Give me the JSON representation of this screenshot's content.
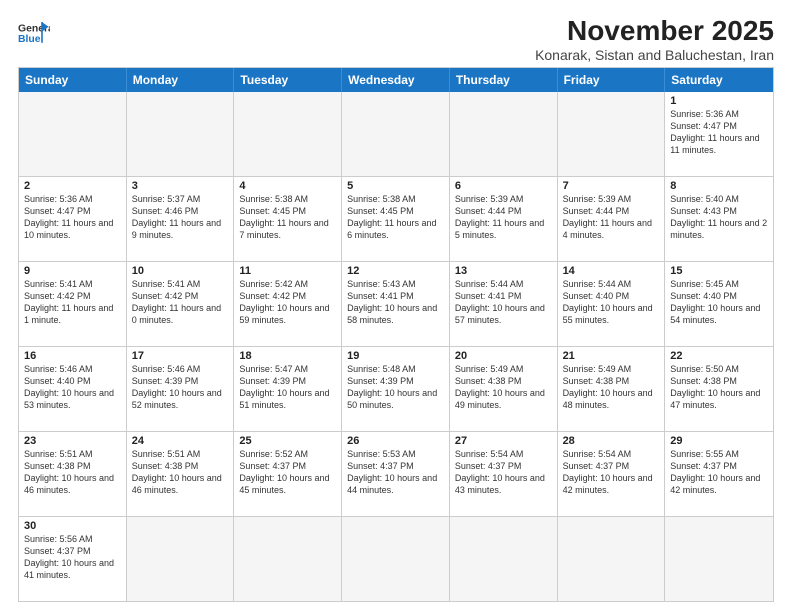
{
  "logo": {
    "line1": "General",
    "line2": "Blue"
  },
  "title": "November 2025",
  "subtitle": "Konarak, Sistan and Baluchestan, Iran",
  "days_of_week": [
    "Sunday",
    "Monday",
    "Tuesday",
    "Wednesday",
    "Thursday",
    "Friday",
    "Saturday"
  ],
  "weeks": [
    [
      {
        "day": "",
        "info": "",
        "empty": true
      },
      {
        "day": "",
        "info": "",
        "empty": true
      },
      {
        "day": "",
        "info": "",
        "empty": true
      },
      {
        "day": "",
        "info": "",
        "empty": true
      },
      {
        "day": "",
        "info": "",
        "empty": true
      },
      {
        "day": "",
        "info": "",
        "empty": true
      },
      {
        "day": "1",
        "info": "Sunrise: 5:36 AM\nSunset: 4:47 PM\nDaylight: 11 hours\nand 11 minutes.",
        "empty": false
      }
    ],
    [
      {
        "day": "2",
        "info": "Sunrise: 5:36 AM\nSunset: 4:47 PM\nDaylight: 11 hours\nand 10 minutes.",
        "empty": false
      },
      {
        "day": "3",
        "info": "Sunrise: 5:37 AM\nSunset: 4:46 PM\nDaylight: 11 hours\nand 9 minutes.",
        "empty": false
      },
      {
        "day": "4",
        "info": "Sunrise: 5:38 AM\nSunset: 4:45 PM\nDaylight: 11 hours\nand 7 minutes.",
        "empty": false
      },
      {
        "day": "5",
        "info": "Sunrise: 5:38 AM\nSunset: 4:45 PM\nDaylight: 11 hours\nand 6 minutes.",
        "empty": false
      },
      {
        "day": "6",
        "info": "Sunrise: 5:39 AM\nSunset: 4:44 PM\nDaylight: 11 hours\nand 5 minutes.",
        "empty": false
      },
      {
        "day": "7",
        "info": "Sunrise: 5:39 AM\nSunset: 4:44 PM\nDaylight: 11 hours\nand 4 minutes.",
        "empty": false
      },
      {
        "day": "8",
        "info": "Sunrise: 5:40 AM\nSunset: 4:43 PM\nDaylight: 11 hours\nand 2 minutes.",
        "empty": false
      }
    ],
    [
      {
        "day": "9",
        "info": "Sunrise: 5:41 AM\nSunset: 4:42 PM\nDaylight: 11 hours\nand 1 minute.",
        "empty": false
      },
      {
        "day": "10",
        "info": "Sunrise: 5:41 AM\nSunset: 4:42 PM\nDaylight: 11 hours\nand 0 minutes.",
        "empty": false
      },
      {
        "day": "11",
        "info": "Sunrise: 5:42 AM\nSunset: 4:42 PM\nDaylight: 10 hours\nand 59 minutes.",
        "empty": false
      },
      {
        "day": "12",
        "info": "Sunrise: 5:43 AM\nSunset: 4:41 PM\nDaylight: 10 hours\nand 58 minutes.",
        "empty": false
      },
      {
        "day": "13",
        "info": "Sunrise: 5:44 AM\nSunset: 4:41 PM\nDaylight: 10 hours\nand 57 minutes.",
        "empty": false
      },
      {
        "day": "14",
        "info": "Sunrise: 5:44 AM\nSunset: 4:40 PM\nDaylight: 10 hours\nand 55 minutes.",
        "empty": false
      },
      {
        "day": "15",
        "info": "Sunrise: 5:45 AM\nSunset: 4:40 PM\nDaylight: 10 hours\nand 54 minutes.",
        "empty": false
      }
    ],
    [
      {
        "day": "16",
        "info": "Sunrise: 5:46 AM\nSunset: 4:40 PM\nDaylight: 10 hours\nand 53 minutes.",
        "empty": false
      },
      {
        "day": "17",
        "info": "Sunrise: 5:46 AM\nSunset: 4:39 PM\nDaylight: 10 hours\nand 52 minutes.",
        "empty": false
      },
      {
        "day": "18",
        "info": "Sunrise: 5:47 AM\nSunset: 4:39 PM\nDaylight: 10 hours\nand 51 minutes.",
        "empty": false
      },
      {
        "day": "19",
        "info": "Sunrise: 5:48 AM\nSunset: 4:39 PM\nDaylight: 10 hours\nand 50 minutes.",
        "empty": false
      },
      {
        "day": "20",
        "info": "Sunrise: 5:49 AM\nSunset: 4:38 PM\nDaylight: 10 hours\nand 49 minutes.",
        "empty": false
      },
      {
        "day": "21",
        "info": "Sunrise: 5:49 AM\nSunset: 4:38 PM\nDaylight: 10 hours\nand 48 minutes.",
        "empty": false
      },
      {
        "day": "22",
        "info": "Sunrise: 5:50 AM\nSunset: 4:38 PM\nDaylight: 10 hours\nand 47 minutes.",
        "empty": false
      }
    ],
    [
      {
        "day": "23",
        "info": "Sunrise: 5:51 AM\nSunset: 4:38 PM\nDaylight: 10 hours\nand 46 minutes.",
        "empty": false
      },
      {
        "day": "24",
        "info": "Sunrise: 5:51 AM\nSunset: 4:38 PM\nDaylight: 10 hours\nand 46 minutes.",
        "empty": false
      },
      {
        "day": "25",
        "info": "Sunrise: 5:52 AM\nSunset: 4:37 PM\nDaylight: 10 hours\nand 45 minutes.",
        "empty": false
      },
      {
        "day": "26",
        "info": "Sunrise: 5:53 AM\nSunset: 4:37 PM\nDaylight: 10 hours\nand 44 minutes.",
        "empty": false
      },
      {
        "day": "27",
        "info": "Sunrise: 5:54 AM\nSunset: 4:37 PM\nDaylight: 10 hours\nand 43 minutes.",
        "empty": false
      },
      {
        "day": "28",
        "info": "Sunrise: 5:54 AM\nSunset: 4:37 PM\nDaylight: 10 hours\nand 42 minutes.",
        "empty": false
      },
      {
        "day": "29",
        "info": "Sunrise: 5:55 AM\nSunset: 4:37 PM\nDaylight: 10 hours\nand 42 minutes.",
        "empty": false
      }
    ],
    [
      {
        "day": "30",
        "info": "Sunrise: 5:56 AM\nSunset: 4:37 PM\nDaylight: 10 hours\nand 41 minutes.",
        "empty": false
      },
      {
        "day": "",
        "info": "",
        "empty": true
      },
      {
        "day": "",
        "info": "",
        "empty": true
      },
      {
        "day": "",
        "info": "",
        "empty": true
      },
      {
        "day": "",
        "info": "",
        "empty": true
      },
      {
        "day": "",
        "info": "",
        "empty": true
      },
      {
        "day": "",
        "info": "",
        "empty": true
      }
    ]
  ]
}
